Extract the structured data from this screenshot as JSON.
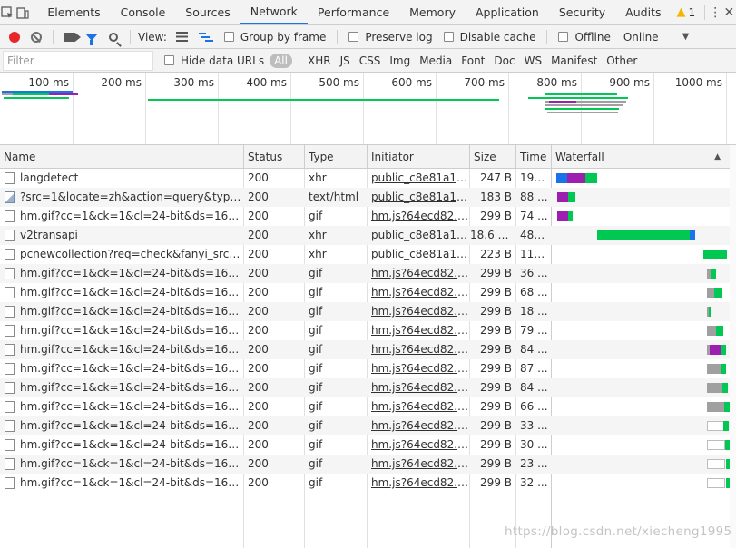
{
  "tabs": [
    "Elements",
    "Console",
    "Sources",
    "Network",
    "Performance",
    "Memory",
    "Application",
    "Security",
    "Audits"
  ],
  "active_tab": "Network",
  "warnings_count": "1",
  "toolbar": {
    "view_label": "View:",
    "group_by_frame": "Group by frame",
    "preserve_log": "Preserve log",
    "disable_cache": "Disable cache",
    "offline": "Offline",
    "throttle_value": "Online"
  },
  "filter": {
    "placeholder": "Filter",
    "hide_data_urls": "Hide data URLs",
    "types": [
      "All",
      "XHR",
      "JS",
      "CSS",
      "Img",
      "Media",
      "Font",
      "Doc",
      "WS",
      "Manifest",
      "Other"
    ]
  },
  "overview": {
    "ticks": [
      "100 ms",
      "200 ms",
      "300 ms",
      "400 ms",
      "500 ms",
      "600 ms",
      "700 ms",
      "800 ms",
      "900 ms",
      "1000 ms"
    ]
  },
  "columns": [
    "Name",
    "Status",
    "Type",
    "Initiator",
    "Size",
    "Time",
    "Waterfall"
  ],
  "rows": [
    {
      "name": "langdetect",
      "status": "200",
      "type": "xhr",
      "initiator": "public_c8e81a1.js...",
      "size": "247 B",
      "time": "199...",
      "icon": "doc"
    },
    {
      "name": "?src=1&locate=zh&action=query&type=1...",
      "status": "200",
      "type": "text/html",
      "initiator": "public_c8e81a1.js...",
      "size": "183 B",
      "time": "88 ...",
      "icon": "img"
    },
    {
      "name": "hm.gif?cc=1&ck=1&cl=24-bit&ds=1680x1...",
      "status": "200",
      "type": "gif",
      "initiator": "hm.js?64ecd82...:21",
      "size": "299 B",
      "time": "74 ...",
      "icon": "doc"
    },
    {
      "name": "v2transapi",
      "status": "200",
      "type": "xhr",
      "initiator": "public_c8e81a1.js...",
      "size": "18.6 KB",
      "time": "482...",
      "icon": "doc"
    },
    {
      "name": "pcnewcollection?req=check&fanyi_src=hell...",
      "status": "200",
      "type": "xhr",
      "initiator": "public_c8e81a1.js...",
      "size": "223 B",
      "time": "114...",
      "icon": "doc"
    },
    {
      "name": "hm.gif?cc=1&ck=1&cl=24-bit&ds=1680x1...",
      "status": "200",
      "type": "gif",
      "initiator": "hm.js?64ecd82...:21",
      "size": "299 B",
      "time": "36 ...",
      "icon": "doc"
    },
    {
      "name": "hm.gif?cc=1&ck=1&cl=24-bit&ds=1680x1...",
      "status": "200",
      "type": "gif",
      "initiator": "hm.js?64ecd82...:21",
      "size": "299 B",
      "time": "68 ...",
      "icon": "doc"
    },
    {
      "name": "hm.gif?cc=1&ck=1&cl=24-bit&ds=1680x1...",
      "status": "200",
      "type": "gif",
      "initiator": "hm.js?64ecd82...:21",
      "size": "299 B",
      "time": "18 ...",
      "icon": "doc"
    },
    {
      "name": "hm.gif?cc=1&ck=1&cl=24-bit&ds=1680x1...",
      "status": "200",
      "type": "gif",
      "initiator": "hm.js?64ecd82...:21",
      "size": "299 B",
      "time": "79 ...",
      "icon": "doc"
    },
    {
      "name": "hm.gif?cc=1&ck=1&cl=24-bit&ds=1680x1...",
      "status": "200",
      "type": "gif",
      "initiator": "hm.js?64ecd82...:21",
      "size": "299 B",
      "time": "84 ...",
      "icon": "doc"
    },
    {
      "name": "hm.gif?cc=1&ck=1&cl=24-bit&ds=1680x1...",
      "status": "200",
      "type": "gif",
      "initiator": "hm.js?64ecd82...:21",
      "size": "299 B",
      "time": "87 ...",
      "icon": "doc"
    },
    {
      "name": "hm.gif?cc=1&ck=1&cl=24-bit&ds=1680x1...",
      "status": "200",
      "type": "gif",
      "initiator": "hm.js?64ecd82...:21",
      "size": "299 B",
      "time": "84 ...",
      "icon": "doc"
    },
    {
      "name": "hm.gif?cc=1&ck=1&cl=24-bit&ds=1680x1...",
      "status": "200",
      "type": "gif",
      "initiator": "hm.js?64ecd82...:21",
      "size": "299 B",
      "time": "66 ...",
      "icon": "doc"
    },
    {
      "name": "hm.gif?cc=1&ck=1&cl=24-bit&ds=1680x1...",
      "status": "200",
      "type": "gif",
      "initiator": "hm.js?64ecd82...:21",
      "size": "299 B",
      "time": "33 ...",
      "icon": "doc"
    },
    {
      "name": "hm.gif?cc=1&ck=1&cl=24-bit&ds=1680x1...",
      "status": "200",
      "type": "gif",
      "initiator": "hm.js?64ecd82...:21",
      "size": "299 B",
      "time": "30 ...",
      "icon": "doc"
    },
    {
      "name": "hm.gif?cc=1&ck=1&cl=24-bit&ds=1680x1...",
      "status": "200",
      "type": "gif",
      "initiator": "hm.js?64ecd82...:21",
      "size": "299 B",
      "time": "23 ...",
      "icon": "doc"
    },
    {
      "name": "hm.gif?cc=1&ck=1&cl=24-bit&ds=1680x1...",
      "status": "200",
      "type": "gif",
      "initiator": "hm.js?64ecd82...:21",
      "size": "299 B",
      "time": "32 ...",
      "icon": "doc"
    }
  ],
  "colors": {
    "waiting": "#a0a0a0",
    "stalled": "#9d1fb0",
    "connect": "#f29c39",
    "ttfb": "#00c853",
    "download": "#1a73e8",
    "accent": "#1a73e8"
  },
  "watermark": "https://blog.csdn.net/xiecheng1995"
}
